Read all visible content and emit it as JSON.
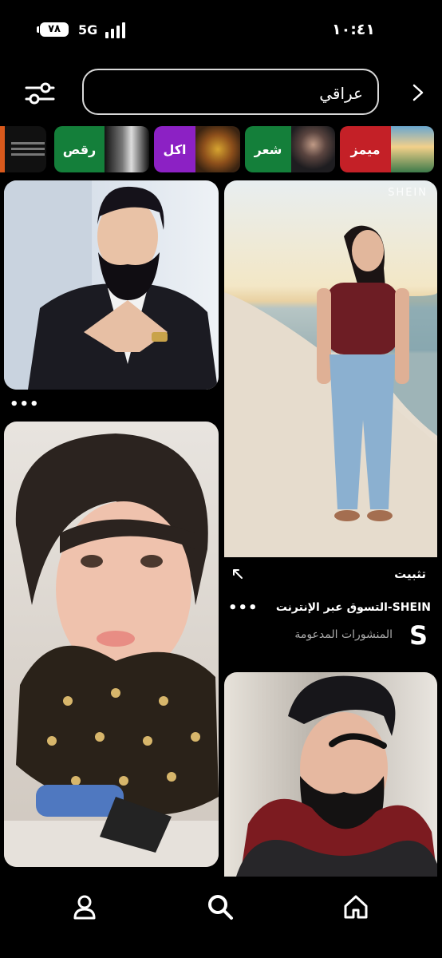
{
  "status_bar": {
    "battery": "٧٨",
    "network": "5G",
    "time": "١٠:٤١"
  },
  "search": {
    "query": "عراقي"
  },
  "chips": [
    {
      "label": "ميمز",
      "color": "#c42027"
    },
    {
      "label": "شعر",
      "color": "#147f3a"
    },
    {
      "label": "اكل",
      "color": "#8c21c4"
    },
    {
      "label": "رقص",
      "color": "#147f3a"
    }
  ],
  "feed": {
    "brand_watermark": "SHEIN",
    "save_label": "تثبيت",
    "sponsor_title": "SHEIN-التسوق عبر الإنترنت",
    "sponsor_subtitle": "المنشورات المدعومة",
    "sponsor_logo_letter": "S",
    "more_glyph": "•••"
  },
  "nav": {
    "items": [
      "profile",
      "search",
      "home"
    ]
  }
}
